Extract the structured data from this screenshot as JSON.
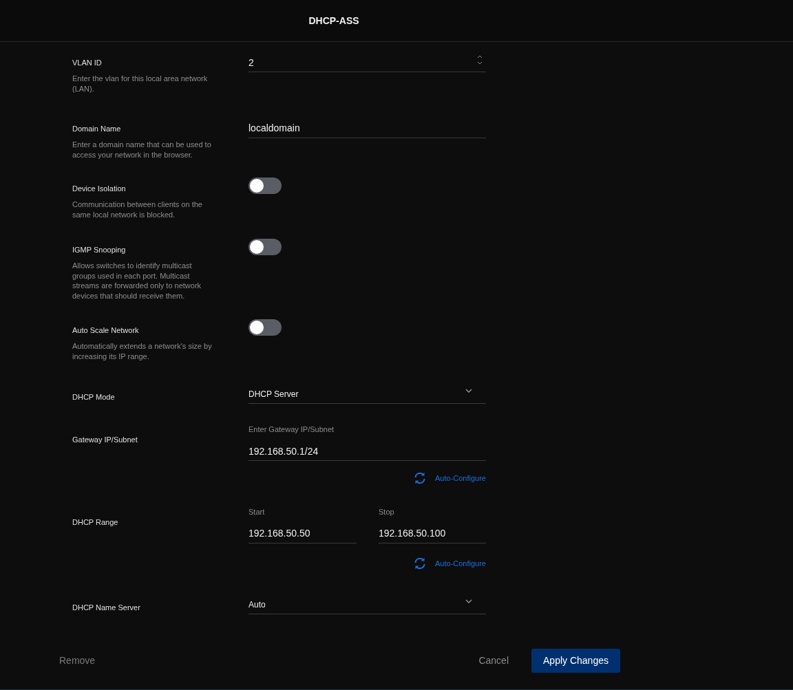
{
  "header": {
    "title": "DHCP-ASS"
  },
  "settings": [
    {
      "kind": "number",
      "label": "VLAN ID",
      "description": "Enter the vlan for this local area network (LAN).",
      "value": "2"
    },
    {
      "kind": "text",
      "label": "Domain Name",
      "description": "Enter a domain name that can be used to access your network in the browser.",
      "value": "localdomain"
    },
    {
      "kind": "toggle",
      "label": "Device Isolation",
      "description": "Communication between clients on the same local network is blocked.",
      "on": false
    },
    {
      "kind": "toggle",
      "label": "IGMP Snooping",
      "description": "Allows switches to identify multicast groups used in each port. Multicast streams are forwarded only to network devices that should receive them.",
      "on": false
    },
    {
      "kind": "toggle",
      "label": "Auto Scale Network",
      "description": "Automatically extends a network's size by increasing its IP range.",
      "on": false
    },
    {
      "kind": "select",
      "label": "DHCP Mode",
      "value": "DHCP Server"
    },
    {
      "kind": "gateway",
      "label": "Gateway IP/Subnet",
      "caption": "Enter Gateway IP/Subnet",
      "value": "192.168.50.1/24",
      "action": "Auto-Configure"
    },
    {
      "kind": "range",
      "label": "DHCP Range",
      "fields": [
        {
          "caption": "Start",
          "value": "192.168.50.50"
        },
        {
          "caption": "Stop",
          "value": "192.168.50.100"
        }
      ],
      "action": "Auto-Configure"
    },
    {
      "kind": "select",
      "label": "DHCP Name Server",
      "value": "Auto"
    }
  ],
  "footer": {
    "remove": "Remove",
    "cancel": "Cancel",
    "apply": "Apply Changes"
  }
}
